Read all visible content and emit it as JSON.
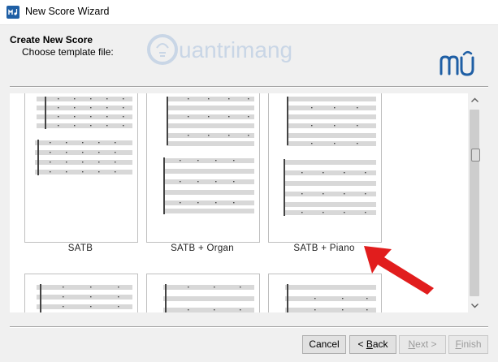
{
  "window": {
    "title": "New Score Wizard"
  },
  "header": {
    "title": "Create New Score",
    "subtitle": "Choose template file:",
    "watermark_text": "uantrimang"
  },
  "templates": [
    {
      "label": "SATB"
    },
    {
      "label": "SATB + Organ"
    },
    {
      "label": "SATB + Piano"
    },
    {
      "label": ""
    },
    {
      "label": ""
    },
    {
      "label": ""
    }
  ],
  "buttons": {
    "cancel": "Cancel",
    "back_prefix": "< ",
    "back_underline": "B",
    "back_suffix": "ack",
    "next_prefix": "",
    "next_underline": "N",
    "next_suffix": "ext >",
    "finish_prefix": "",
    "finish_underline": "F",
    "finish_suffix": "inish"
  },
  "colors": {
    "arrow": "#e11d1d",
    "accent": "#1f5fa5",
    "watermark": "#c9d6e6"
  },
  "icons": {
    "app": "musescore-app-icon",
    "logo": "musescore-logo-icon",
    "arrow": "red-arrow-annotation"
  }
}
